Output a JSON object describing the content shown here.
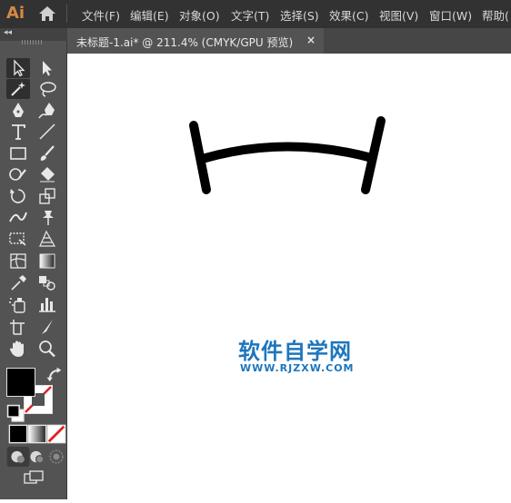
{
  "app": {
    "logo": "Ai"
  },
  "menu": [
    "文件(F)",
    "编辑(E)",
    "对象(O)",
    "文字(T)",
    "选择(S)",
    "效果(C)",
    "视图(V)",
    "窗口(W)",
    "帮助("
  ],
  "document_tab": {
    "title": "未标题-1.ai* @ 211.4% (CMYK/GPU 预览)",
    "close": "×"
  },
  "toolbar": {
    "collapse": "◂◂",
    "tools": [
      "selection-tool",
      "direct-selection-tool",
      "magic-wand-tool",
      "lasso-tool",
      "pen-tool",
      "curvature-tool",
      "type-tool",
      "line-segment-tool",
      "rectangle-tool",
      "paintbrush-tool",
      "shaper-tool",
      "eraser-tool",
      "rotate-tool",
      "scale-tool",
      "width-tool",
      "puppet-warp-tool",
      "free-transform-tool",
      "perspective-grid-tool",
      "mesh-tool",
      "gradient-tool",
      "eyedropper-tool",
      "blend-tool",
      "symbol-sprayer-tool",
      "column-graph-tool",
      "artboard-tool",
      "slice-tool",
      "hand-tool",
      "zoom-tool"
    ],
    "active_tool": "selection-tool"
  },
  "colors": {
    "ui_dark": "#323232",
    "panel": "#535353",
    "accent": "#d58a44",
    "fill": "#000000",
    "stroke_none": "#e02020",
    "watermark": "#1d76bd"
  },
  "watermark": {
    "cn": "软件自学网",
    "en": "WWW.RJZXW.COM"
  }
}
